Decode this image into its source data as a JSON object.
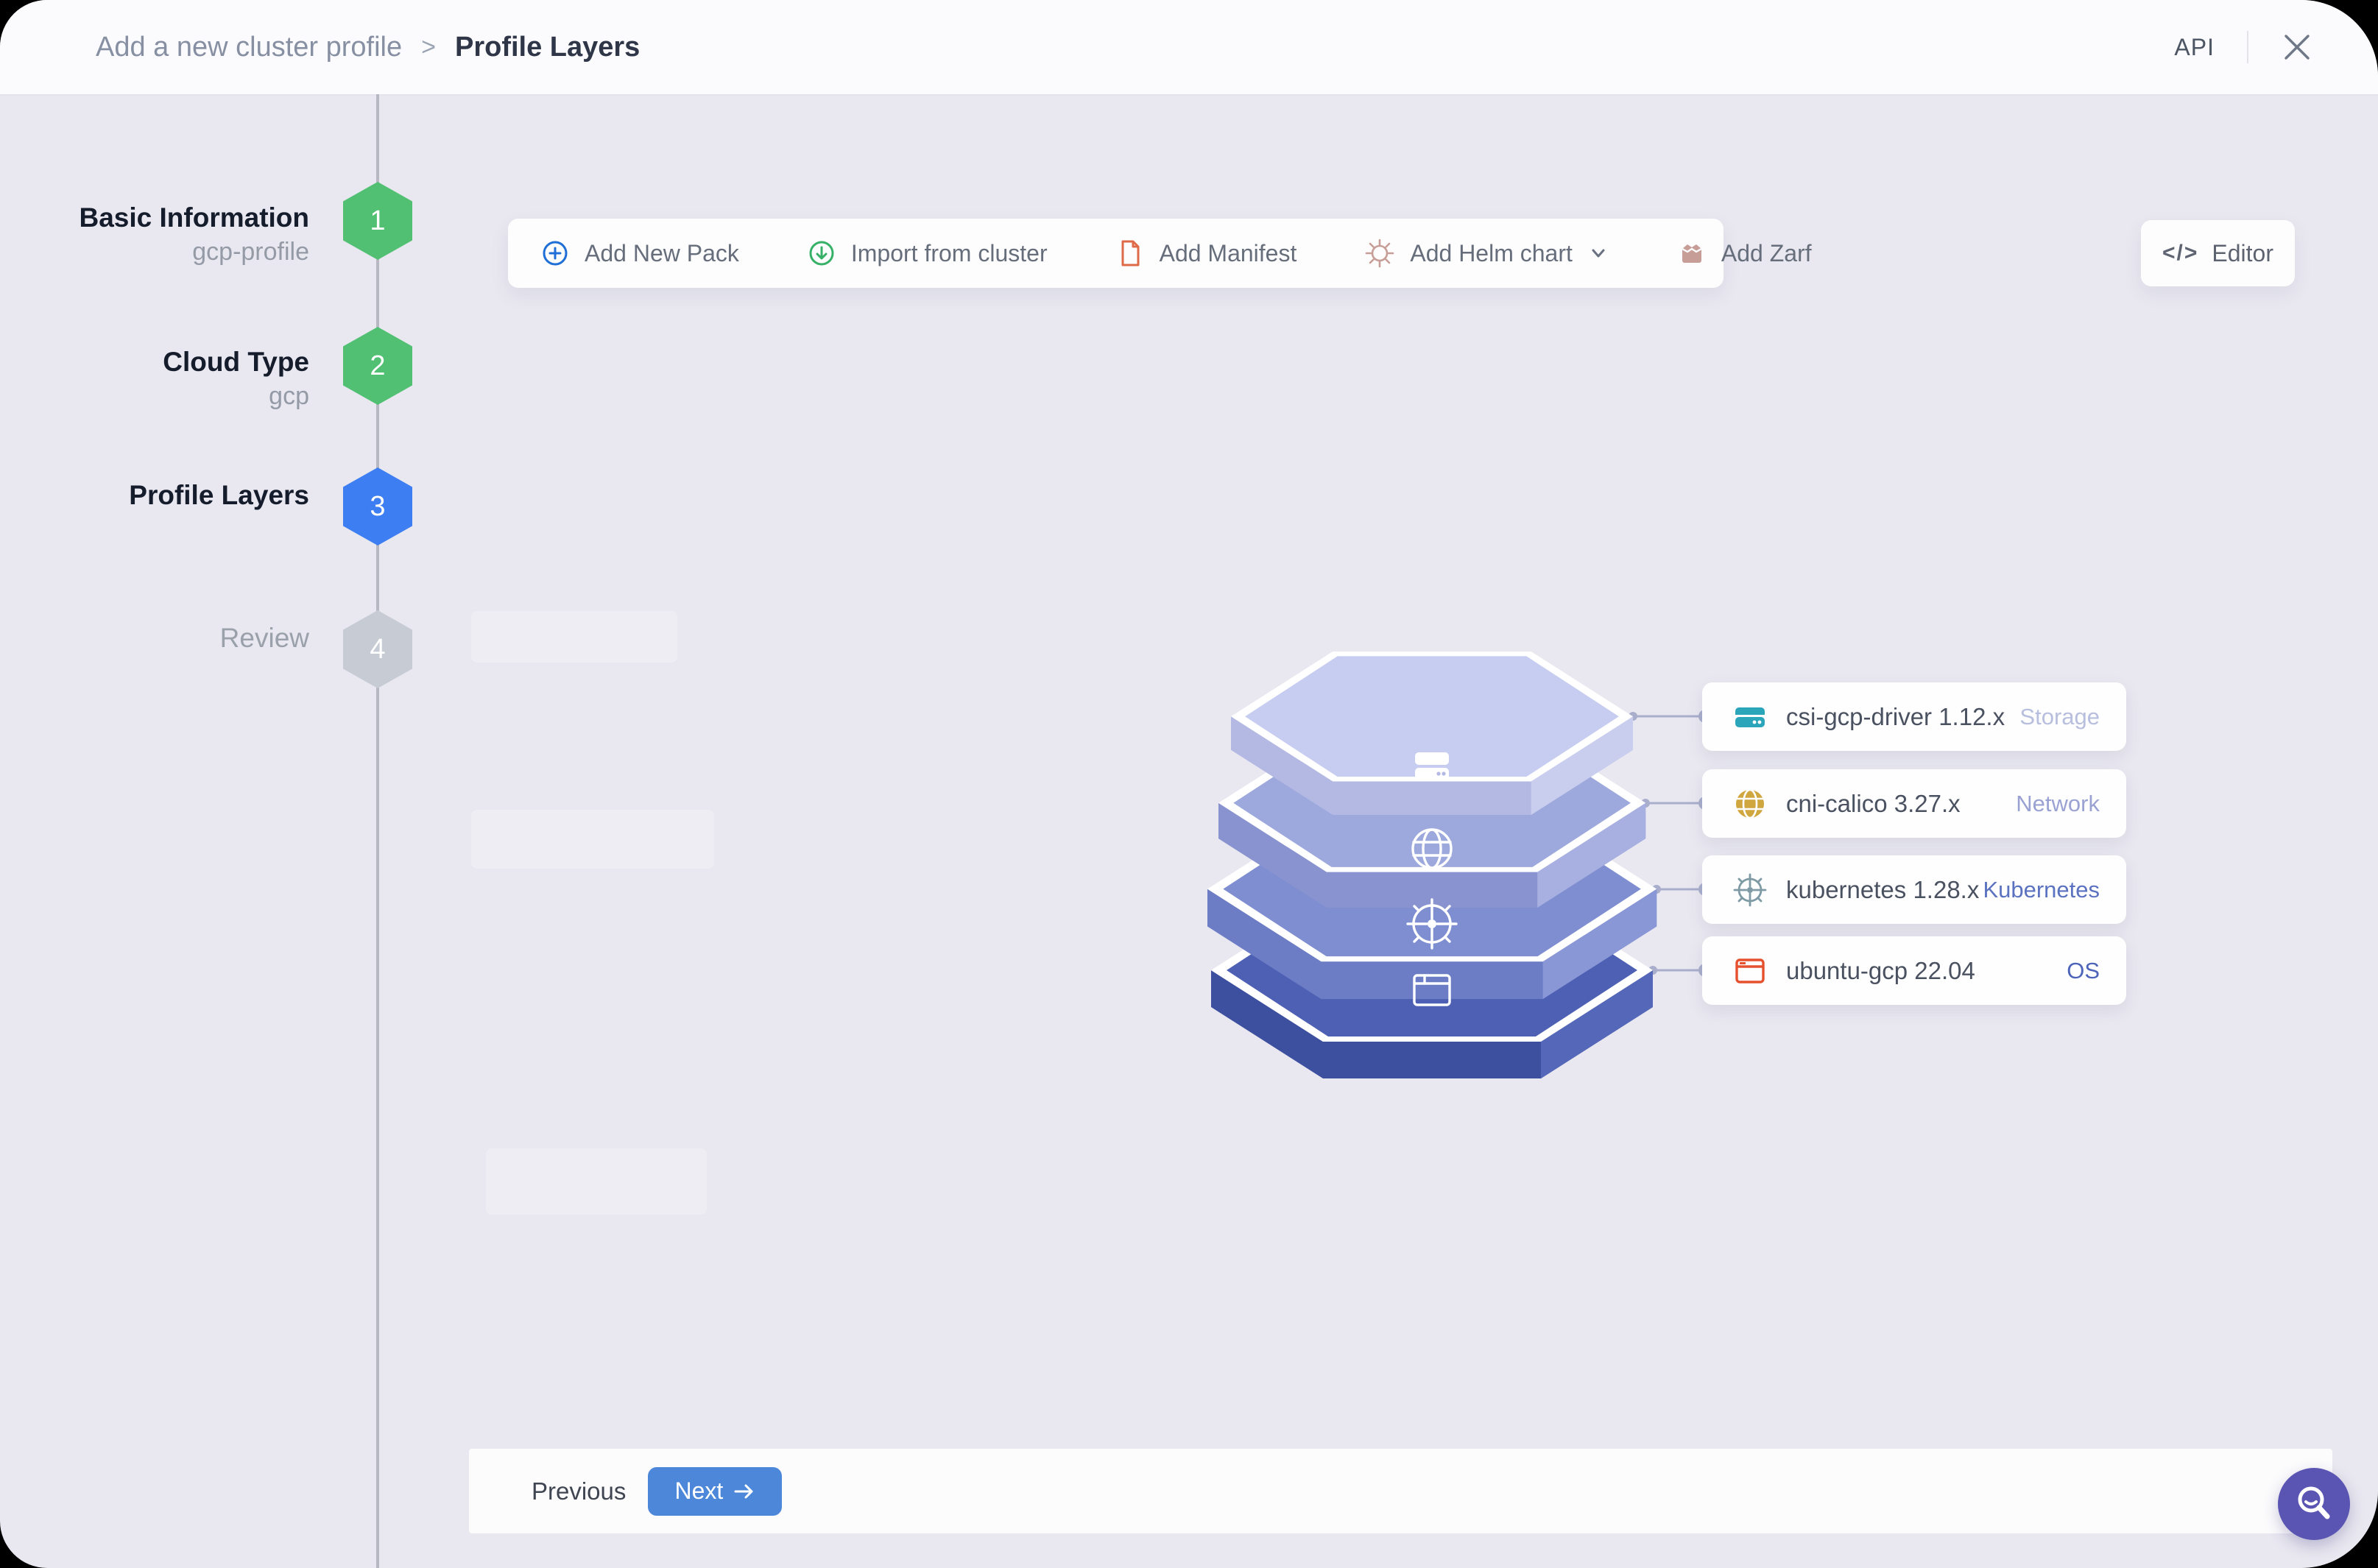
{
  "header": {
    "breadcrumb_parent": "Add a new cluster profile",
    "breadcrumb_separator": ">",
    "breadcrumb_current": "Profile Layers",
    "api_label": "API"
  },
  "steps": [
    {
      "number": "1",
      "label": "Basic Information",
      "sublabel": "gcp-profile",
      "state": "completed"
    },
    {
      "number": "2",
      "label": "Cloud Type",
      "sublabel": "gcp",
      "state": "completed"
    },
    {
      "number": "3",
      "label": "Profile Layers",
      "sublabel": "",
      "state": "active"
    },
    {
      "number": "4",
      "label": "Review",
      "sublabel": "",
      "state": "pending"
    }
  ],
  "toolbar": {
    "items": [
      {
        "label": "Add New Pack",
        "icon": "plus-circle-icon"
      },
      {
        "label": "Import from cluster",
        "icon": "arrow-down-circle-icon"
      },
      {
        "label": "Add Manifest",
        "icon": "manifest-file-icon"
      },
      {
        "label": "Add Helm chart",
        "icon": "helm-wheel-icon",
        "has_dropdown": true
      },
      {
        "label": "Add Zarf",
        "icon": "zarf-package-icon"
      }
    ],
    "editor_label": "Editor",
    "editor_glyph": "</>"
  },
  "layers": [
    {
      "name": "storage",
      "icon": "storage-drive-icon",
      "color": "#c7cdf0"
    },
    {
      "name": "network",
      "icon": "globe-icon",
      "color": "#9da9dd"
    },
    {
      "name": "kubernetes",
      "icon": "kubernetes-wheel-icon",
      "color": "#7e8ed1"
    },
    {
      "name": "os",
      "icon": "os-window-icon",
      "color": "#4e60b4"
    }
  ],
  "packs": [
    {
      "name": "csi-gcp-driver 1.12.x",
      "category": "Storage",
      "icon": "storage-drive-icon",
      "icon_color": "#2aa5ba",
      "category_color": "#b8bede"
    },
    {
      "name": "cni-calico 3.27.x",
      "category": "Network",
      "icon": "globe-icon",
      "icon_color": "#d0a63e",
      "category_color": "#9aa2d3"
    },
    {
      "name": "kubernetes 1.28.x",
      "category": "Kubernetes",
      "icon": "kubernetes-wheel-icon",
      "icon_color": "#7e9aa5",
      "category_color": "#5b72c0"
    },
    {
      "name": "ubuntu-gcp 22.04",
      "category": "OS",
      "icon": "os-window-icon",
      "icon_color": "#e5512e",
      "category_color": "#4d64ba"
    }
  ],
  "footer": {
    "previous_label": "Previous",
    "next_label": "Next"
  },
  "colors": {
    "step_completed": "#52c072",
    "step_active": "#3d7ef2",
    "step_pending": "#c7ccd4",
    "next_button": "#4c87da",
    "fab_purple": "#5a54b2",
    "background": "#e9e8f0"
  }
}
